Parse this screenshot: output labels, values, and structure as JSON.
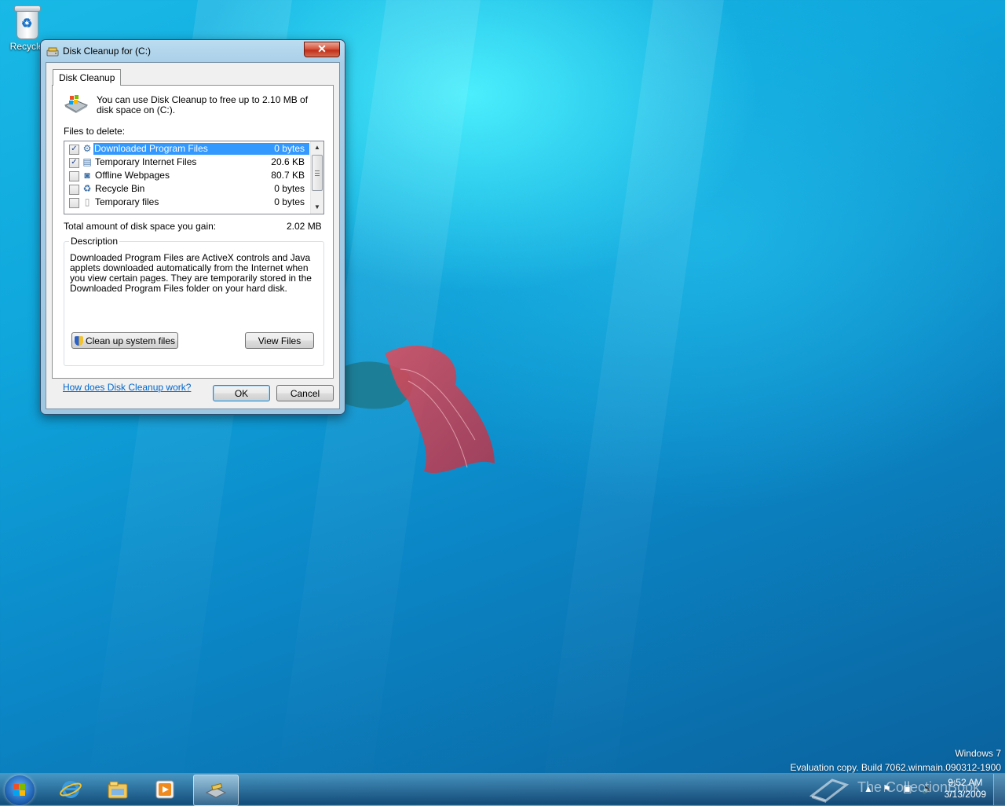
{
  "desktop": {
    "icons": [
      {
        "label": "Recycle",
        "icon": "recycle-bin-icon"
      }
    ]
  },
  "window": {
    "title": "Disk Cleanup for  (C:)",
    "close_label": "✕",
    "tab": "Disk Cleanup",
    "intro": "You can use Disk Cleanup to free up to 2.10 MB of disk space on  (C:).",
    "files_label": "Files to delete:",
    "files": [
      {
        "name": "Downloaded Program Files",
        "size": "0 bytes",
        "checked": true,
        "selected": true,
        "icon": "downloaded-program-files-icon"
      },
      {
        "name": "Temporary Internet Files",
        "size": "20.6 KB",
        "checked": true,
        "selected": false,
        "icon": "temporary-internet-files-icon"
      },
      {
        "name": "Offline Webpages",
        "size": "80.7 KB",
        "checked": false,
        "selected": false,
        "icon": "offline-webpages-icon"
      },
      {
        "name": "Recycle Bin",
        "size": "0 bytes",
        "checked": false,
        "selected": false,
        "icon": "recycle-bin-icon"
      },
      {
        "name": "Temporary files",
        "size": "0 bytes",
        "checked": false,
        "selected": false,
        "icon": "temporary-files-icon"
      }
    ],
    "total_label": "Total amount of disk space you gain:",
    "total_value": "2.02 MB",
    "description_title": "Description",
    "description": "Downloaded Program Files are ActiveX controls and Java applets downloaded automatically from the Internet when you view certain pages. They are temporarily stored in the Downloaded Program Files folder on your hard disk.",
    "cleanup_system_label": "Clean up system files",
    "view_files_label": "View Files",
    "help_link": "How does Disk Cleanup work?",
    "ok_label": "OK",
    "cancel_label": "Cancel"
  },
  "watermark": {
    "line1": "Windows 7",
    "line2": "Evaluation copy. Build 7062.winmain.090312-1900"
  },
  "taskbar": {
    "pinned": [
      "internet-explorer-icon",
      "windows-explorer-icon",
      "media-player-icon",
      "disk-cleanup-icon"
    ],
    "brand": "The CollectionBook",
    "time": "9:52 AM",
    "date": "3/13/2009"
  },
  "colors": {
    "selection": "#3399ff",
    "link": "#0066cc",
    "close": "#c0301a"
  }
}
